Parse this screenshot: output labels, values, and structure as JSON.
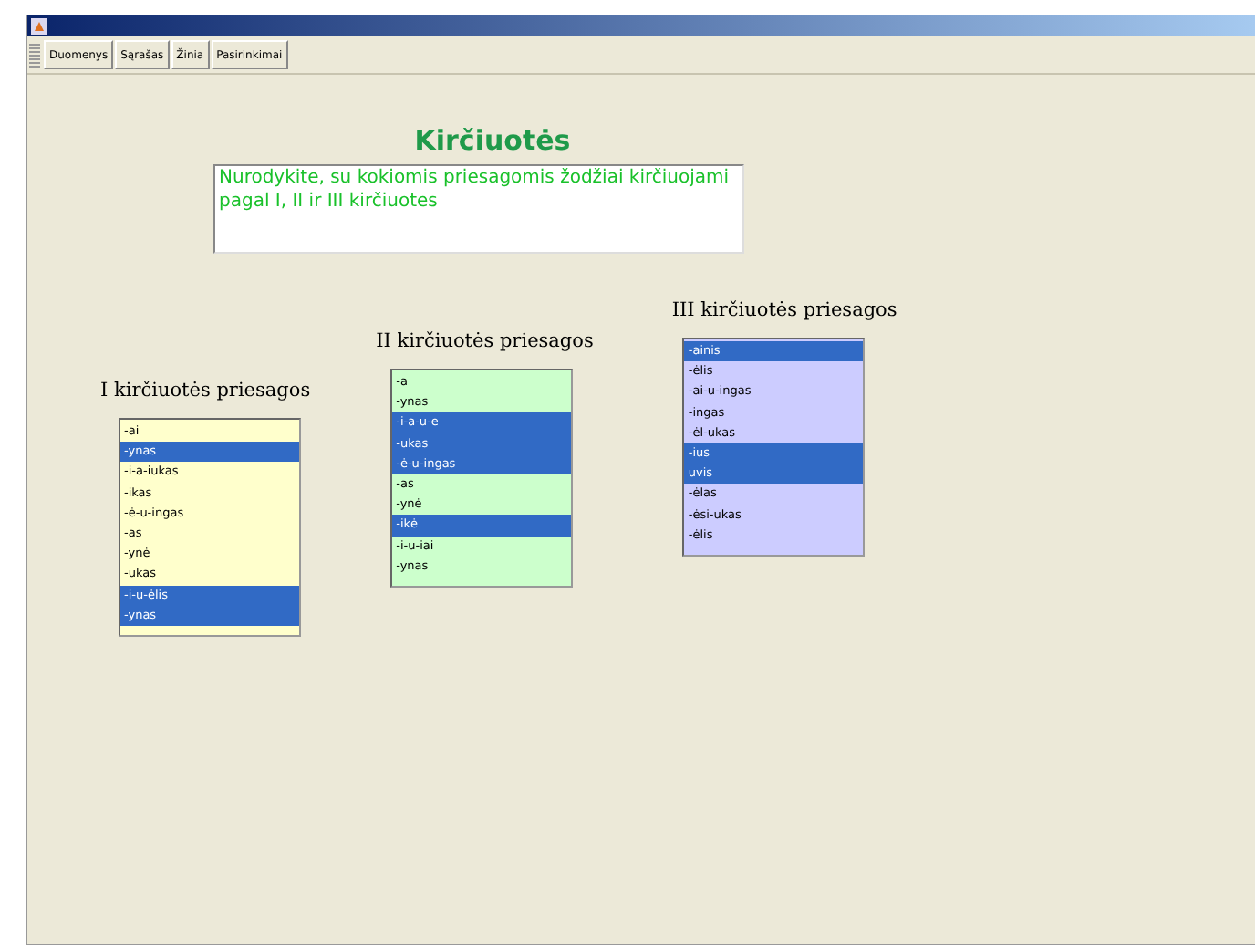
{
  "toolbar": {
    "buttons": [
      {
        "label": "Duomenys"
      },
      {
        "label": "Sąrašas"
      },
      {
        "label": "Žinia"
      },
      {
        "label": "Pasirinkimai"
      }
    ]
  },
  "heading": "Kirčiuotės",
  "instruction": "Nurodykite, su kokiomis priesagomis žodžiai kirčiuojami pagal I, II ir III kirčiuotes",
  "lists": [
    {
      "label": "I kirčiuotės priesagos",
      "color": "#ffffcc",
      "items": [
        {
          "text": "-ai",
          "selected": false
        },
        {
          "text": "-ynas",
          "selected": true
        },
        {
          "text": "-i-a-iukas",
          "selected": false
        },
        {
          "text": "-ikas",
          "selected": false
        },
        {
          "text": "-ė-u-ingas",
          "selected": false
        },
        {
          "text": "-as",
          "selected": false
        },
        {
          "text": "-ynė",
          "selected": false
        },
        {
          "text": "-ukas",
          "selected": false
        },
        {
          "text": "-i-u-ėlis",
          "selected": true
        },
        {
          "text": "-ynas",
          "selected": true
        }
      ]
    },
    {
      "label": "II kirčiuotės priesagos",
      "color": "#ccffcc",
      "items": [
        {
          "text": "-a",
          "selected": false
        },
        {
          "text": "-ynas",
          "selected": false
        },
        {
          "text": "-i-a-u-e",
          "selected": true
        },
        {
          "text": "-ukas",
          "selected": true
        },
        {
          "text": "-ė-u-ingas",
          "selected": true
        },
        {
          "text": "-as",
          "selected": false
        },
        {
          "text": "-ynė",
          "selected": false
        },
        {
          "text": "-ikė",
          "selected": true
        },
        {
          "text": "-i-u-iai",
          "selected": false
        },
        {
          "text": "-ynas",
          "selected": false
        }
      ]
    },
    {
      "label": "III kirčiuotės priesagos",
      "color": "#ccccff",
      "items": [
        {
          "text": "-ainis",
          "selected": true
        },
        {
          "text": "-ėlis",
          "selected": false
        },
        {
          "text": "-ai-u-ingas",
          "selected": false
        },
        {
          "text": "-ingas",
          "selected": false
        },
        {
          "text": "-ėl-ukas",
          "selected": false
        },
        {
          "text": "-ius",
          "selected": true
        },
        {
          "text": "uvis",
          "selected": true
        },
        {
          "text": "-ėlas",
          "selected": false
        },
        {
          "text": "-ėsi-ukas",
          "selected": false
        },
        {
          "text": "-ėlis",
          "selected": false
        }
      ]
    }
  ]
}
